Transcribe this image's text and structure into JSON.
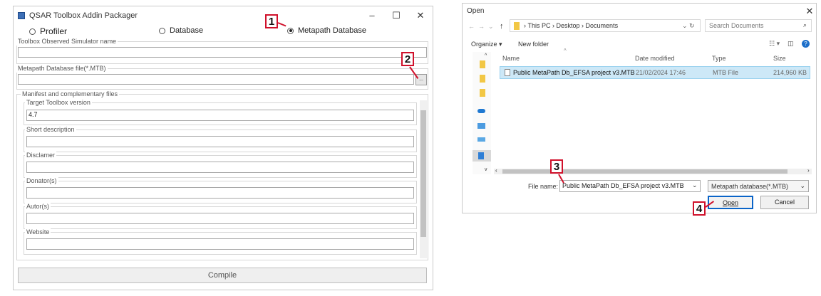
{
  "packager": {
    "title": "QSAR Toolbox Addin Packager",
    "controls": {
      "minimize": "–",
      "maximize": "☐",
      "close": "✕"
    },
    "radios": [
      {
        "label": "Profiler",
        "selected": false
      },
      {
        "label": "Database",
        "selected": false
      },
      {
        "label": "Metapath Database",
        "selected": true
      }
    ],
    "simulator_group_label": "Toolbox Observed Simulator name",
    "simulator_value": "",
    "db_file_group_label": "Metapath Database file(*.MTB)",
    "db_file_value": "",
    "browse_label": "...",
    "manifest_group_label": "Manifest and complementary files",
    "fields": [
      {
        "label": "Target Toolbox version",
        "value": "4.7"
      },
      {
        "label": "Short description",
        "value": ""
      },
      {
        "label": "Disclamer",
        "value": ""
      },
      {
        "label": "Donator(s)",
        "value": ""
      },
      {
        "label": "Autor(s)",
        "value": ""
      },
      {
        "label": "Website",
        "value": ""
      }
    ],
    "compile_label": "Compile"
  },
  "callouts": [
    "1",
    "2",
    "3",
    "4"
  ],
  "open_dialog": {
    "title": "Open",
    "close": "✕",
    "breadcrumb": [
      "This PC",
      "Desktop",
      "Documents"
    ],
    "search_placeholder": "Search Documents",
    "organize_label": "Organize ▾",
    "new_folder_label": "New folder",
    "columns": {
      "name": "Name",
      "date": "Date modified",
      "type": "Type",
      "size": "Size"
    },
    "files": [
      {
        "name": "Public MetaPath Db_EFSA project v3.MTB",
        "date": "21/02/2024 17:46",
        "type": "MTB File",
        "size": "214,960 KB",
        "selected": true
      }
    ],
    "filename_label": "File name:",
    "filename_value": "Public MetaPath Db_EFSA project v3.MTB",
    "filter_value": "Metapath database(*.MTB)",
    "open_label": "Open",
    "cancel_label": "Cancel"
  },
  "colors": {
    "callout_border": "#d0112b",
    "selection": "#cde8f7",
    "primary_border": "#0a64c8"
  },
  "icons": [
    "radio-icon",
    "browse-icon",
    "back-arrow-icon",
    "forward-arrow-icon",
    "up-arrow-icon",
    "folder-icon",
    "refresh-icon",
    "search-icon",
    "view-options-icon",
    "preview-pane-icon",
    "help-icon",
    "file-icon",
    "cloud-icon",
    "pc-icon",
    "chevron-down-icon",
    "close-icon"
  ]
}
